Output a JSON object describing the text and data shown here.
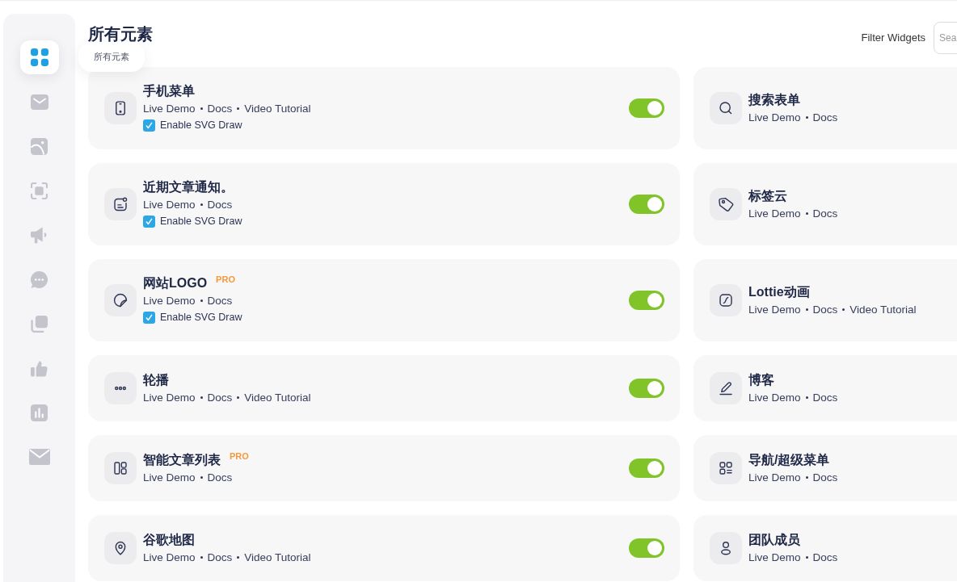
{
  "sidebar": {
    "items": [
      {
        "selected": true,
        "tooltip": "所有元素"
      },
      {
        "selected": false
      },
      {
        "selected": false
      },
      {
        "selected": false
      },
      {
        "selected": false
      },
      {
        "selected": false
      },
      {
        "selected": false
      },
      {
        "selected": false
      },
      {
        "selected": false
      },
      {
        "selected": false
      }
    ]
  },
  "header": {
    "title": "所有元素",
    "filter_label": "Filter Widgets",
    "search": {
      "placeholder": "Sea"
    }
  },
  "widgets": [
    {
      "title": "手机菜单",
      "links": [
        "Live Demo",
        "Docs",
        "Video Tutorial"
      ],
      "svg_draw": {
        "label": "Enable SVG Draw",
        "checked": true
      },
      "on": true
    },
    {
      "title": "搜索表单",
      "links": [
        "Live Demo",
        "Docs"
      ]
    },
    {
      "title": "近期文章通知。",
      "links": [
        "Live Demo",
        "Docs"
      ],
      "svg_draw": {
        "label": "Enable SVG Draw",
        "checked": true
      },
      "on": true
    },
    {
      "title": "标签云",
      "links": [
        "Live Demo",
        "Docs"
      ]
    },
    {
      "title": "网站LOGO",
      "badge": "PRO",
      "links": [
        "Live Demo",
        "Docs"
      ],
      "svg_draw": {
        "label": "Enable SVG Draw",
        "checked": true
      },
      "on": true
    },
    {
      "title": "Lottie动画",
      "links": [
        "Live Demo",
        "Docs",
        "Video Tutorial"
      ]
    },
    {
      "title": "轮播",
      "links": [
        "Live Demo",
        "Docs",
        "Video Tutorial"
      ],
      "on": true
    },
    {
      "title": "博客",
      "links": [
        "Live Demo",
        "Docs"
      ]
    },
    {
      "title": "智能文章列表",
      "badge": "PRO",
      "links": [
        "Live Demo",
        "Docs"
      ],
      "on": true
    },
    {
      "title": "导航/超级菜单",
      "links": [
        "Live Demo",
        "Docs"
      ]
    },
    {
      "title": "谷歌地图",
      "links": [
        "Live Demo",
        "Docs",
        "Video Tutorial"
      ],
      "on": true
    },
    {
      "title": "团队成员",
      "links": [
        "Live Demo",
        "Docs"
      ]
    }
  ]
}
